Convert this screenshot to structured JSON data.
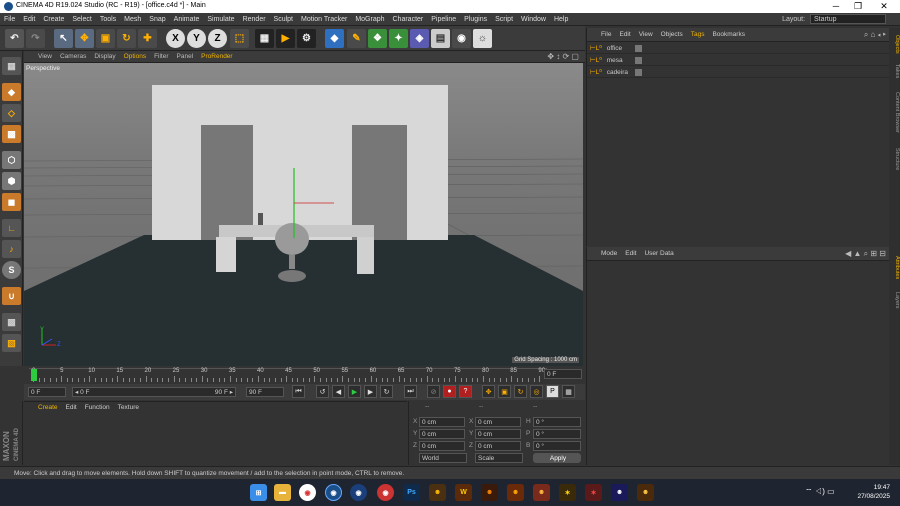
{
  "titlebar": {
    "title": "CINEMA 4D R19.024 Studio (RC - R19) - [office.c4d *] - Main",
    "minimize": "─",
    "maximize": "❐",
    "close": "✕"
  },
  "menu": [
    "File",
    "Edit",
    "Create",
    "Select",
    "Tools",
    "Mesh",
    "Snap",
    "Animate",
    "Simulate",
    "Render",
    "Sculpt",
    "Motion Tracker",
    "MoGraph",
    "Character",
    "Pipeline",
    "Plugins",
    "Script",
    "Window",
    "Help"
  ],
  "layout": {
    "label": "Layout:",
    "value": "Startup"
  },
  "toolbar": {
    "x": "X",
    "y": "Y",
    "z": "Z"
  },
  "viewport": {
    "menu": [
      "View",
      "Cameras",
      "Display",
      "Options",
      "Filter",
      "Panel",
      "ProRender"
    ],
    "label": "Perspective",
    "grid_spacing": "Grid Spacing : 1000 cm",
    "axis_y": "Y",
    "axis_z": "Z"
  },
  "timeline": {
    "ticks": [
      "0",
      "5",
      "10",
      "15",
      "20",
      "25",
      "30",
      "35",
      "40",
      "45",
      "50",
      "55",
      "60",
      "65",
      "70",
      "75",
      "80",
      "85",
      "90"
    ],
    "current": "0 F",
    "start": "0 F",
    "min": "◂ 0 F",
    "max": "90 F ▸",
    "end": "90 F"
  },
  "material": {
    "menu": [
      "Create",
      "Edit",
      "Function",
      "Texture"
    ]
  },
  "maxon": {
    "line1": "MAXON",
    "line2": "CINEMA 4D"
  },
  "coords": {
    "header": [
      "--",
      "--",
      "--"
    ],
    "rows": [
      {
        "a": "X",
        "av": "0 cm",
        "b": "X",
        "bv": "0 cm",
        "c": "H",
        "cv": "0 °"
      },
      {
        "a": "Y",
        "av": "0 cm",
        "b": "Y",
        "bv": "0 cm",
        "c": "P",
        "cv": "0 °"
      },
      {
        "a": "Z",
        "av": "0 cm",
        "b": "Z",
        "bv": "0 cm",
        "c": "B",
        "cv": "0 °"
      }
    ],
    "world": "World",
    "scale": "Scale",
    "apply": "Apply"
  },
  "objects": {
    "menu": [
      "File",
      "Edit",
      "View",
      "Objects",
      "Tags",
      "Bookmarks"
    ],
    "items": [
      "office",
      "mesa",
      "cadeira"
    ]
  },
  "attributes": {
    "menu": [
      "Mode",
      "Edit",
      "User Data"
    ]
  },
  "side_tabs": [
    "Objects",
    "Takes",
    "Content Browser",
    "Structure",
    "Attributes",
    "Layers"
  ],
  "status": "Move: Click and drag to move elements. Hold down SHIFT to quantize movement / add to the selection in point mode, CTRL to remove.",
  "taskbar": {
    "time": "19:47",
    "date": "27/08/2025",
    "ps": "Ps"
  }
}
